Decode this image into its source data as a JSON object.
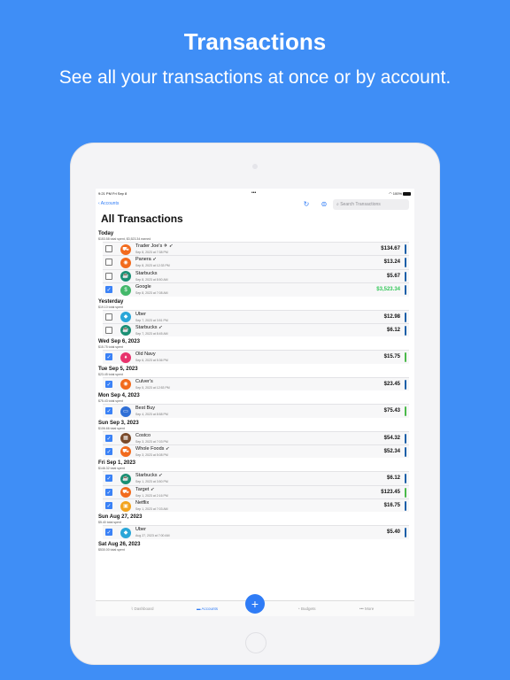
{
  "hero": {
    "title": "Transactions",
    "subtitle": "See all your transactions at once or by account."
  },
  "status": {
    "time": "9:21 PM   Fri Sep 8",
    "dots": "•••",
    "battery": "100%"
  },
  "nav": {
    "back_label": "Accounts",
    "search_placeholder": "Search Transactions"
  },
  "page_title": "All Transactions",
  "groups": [
    {
      "title": "Today",
      "summary": "$153.58 total spent, $3,523.34 earned",
      "rows": [
        {
          "merchant": "Trader Joe's ✈ ➶",
          "time": "Sep 8, 2023 at 7:38 PM",
          "amount": "$134.67",
          "checked": false,
          "icon": "cart-icon",
          "icon_color": "#f26b1d",
          "bar": "#1b5fa8"
        },
        {
          "merchant": "Panera ➶",
          "time": "Sep 8, 2023 at 12:33 PM",
          "amount": "$13.24",
          "checked": false,
          "icon": "food-icon",
          "icon_color": "#f26b1d",
          "bar": "#1b5fa8"
        },
        {
          "merchant": "Starbucks",
          "time": "Sep 8, 2023 at 8:50 AM",
          "amount": "$5.67",
          "checked": false,
          "icon": "coffee-icon",
          "icon_color": "#1a8f73",
          "bar": "#1b5fa8"
        },
        {
          "merchant": "Google",
          "time": "Sep 8, 2023 at 7:08 AM",
          "amount": "$3,523.34",
          "checked": true,
          "icon": "paycheck-icon",
          "icon_color": "#43b86a",
          "bar": "#1b5fa8",
          "positive": true
        }
      ]
    },
    {
      "title": "Yesterday",
      "summary": "$19.10 total spent",
      "rows": [
        {
          "merchant": "Uber",
          "time": "Sep 7, 2023 at 3:51 PM",
          "amount": "$12.98",
          "checked": false,
          "icon": "car-icon",
          "icon_color": "#2aa6d8",
          "bar": "#1b5fa8"
        },
        {
          "merchant": "Starbucks ➶",
          "time": "Sep 7, 2023 at 8:45 AM",
          "amount": "$6.12",
          "checked": false,
          "icon": "coffee-icon",
          "icon_color": "#1a8f73",
          "bar": "#1b5fa8"
        }
      ]
    },
    {
      "title": "Wed Sep 6, 2023",
      "summary": "$15.75 total spent",
      "rows": [
        {
          "merchant": "Old Navy",
          "time": "Sep 6, 2023 at 5:36 PM",
          "amount": "$15.75",
          "checked": true,
          "icon": "shirt-icon",
          "icon_color": "#e8336d",
          "bar": "#4ab94a"
        }
      ]
    },
    {
      "title": "Tue Sep 5, 2023",
      "summary": "$23.45 total spent",
      "rows": [
        {
          "merchant": "Culver's",
          "time": "Sep 5, 2023 at 12:53 PM",
          "amount": "$23.45",
          "checked": true,
          "icon": "food-icon",
          "icon_color": "#f26b1d",
          "bar": "#1b5fa8"
        }
      ]
    },
    {
      "title": "Mon Sep 4, 2023",
      "summary": "$75.43 total spent",
      "rows": [
        {
          "merchant": "Best Buy",
          "time": "Sep 4, 2023 at 8:58 PM",
          "amount": "$75.43",
          "checked": true,
          "icon": "monitor-icon",
          "icon_color": "#2f6fd6",
          "bar": "#4ab94a"
        }
      ]
    },
    {
      "title": "Sun Sep 3, 2023",
      "summary": "$106.66 total spent",
      "rows": [
        {
          "merchant": "Costco",
          "time": "Sep 3, 2023 at 7:03 PM",
          "amount": "$54.32",
          "checked": true,
          "icon": "store-icon",
          "icon_color": "#7a4a2a",
          "bar": "#1b5fa8"
        },
        {
          "merchant": "Whole Foods ➶",
          "time": "Sep 3, 2023 at 5:08 PM",
          "amount": "$52.34",
          "checked": true,
          "icon": "cart-icon",
          "icon_color": "#f26b1d",
          "bar": "#1b5fa8"
        }
      ]
    },
    {
      "title": "Fri Sep 1, 2023",
      "summary": "$146.32 total spent",
      "rows": [
        {
          "merchant": "Starbucks ➶",
          "time": "Sep 1, 2023 at 3:50 PM",
          "amount": "$6.12",
          "checked": true,
          "icon": "coffee-icon",
          "icon_color": "#1a8f73",
          "bar": "#1b5fa8"
        },
        {
          "merchant": "Target ➶",
          "time": "Sep 1, 2023 at 2:16 PM",
          "amount": "$123.45",
          "checked": true,
          "icon": "cart-icon",
          "icon_color": "#f26b1d",
          "bar": "#4ab94a"
        },
        {
          "merchant": "Netflix",
          "time": "Sep 1, 2023 at 7:03 AM",
          "amount": "$16.75",
          "checked": true,
          "icon": "tv-icon",
          "icon_color": "#f2a31d",
          "bar": "#1b5fa8"
        }
      ]
    },
    {
      "title": "Sun Aug 27, 2023",
      "summary": "$5.40 total spent",
      "rows": [
        {
          "merchant": "Uber",
          "time": "Aug 27, 2023 at 7:00 AM",
          "amount": "$5.40",
          "checked": true,
          "icon": "car-icon",
          "icon_color": "#2aa6d8",
          "bar": "#1b5fa8"
        }
      ]
    },
    {
      "title": "Sat Aug 26, 2023",
      "summary": "$530.00 total spent",
      "rows": []
    }
  ],
  "tabs": {
    "dashboard": "Dashboard",
    "accounts": "Accounts",
    "add": "+",
    "budgets": "Budgets",
    "more": "More"
  },
  "colors": {
    "background": "#3f8ef6",
    "accent": "#2f7cf6",
    "positive": "#34c759"
  }
}
